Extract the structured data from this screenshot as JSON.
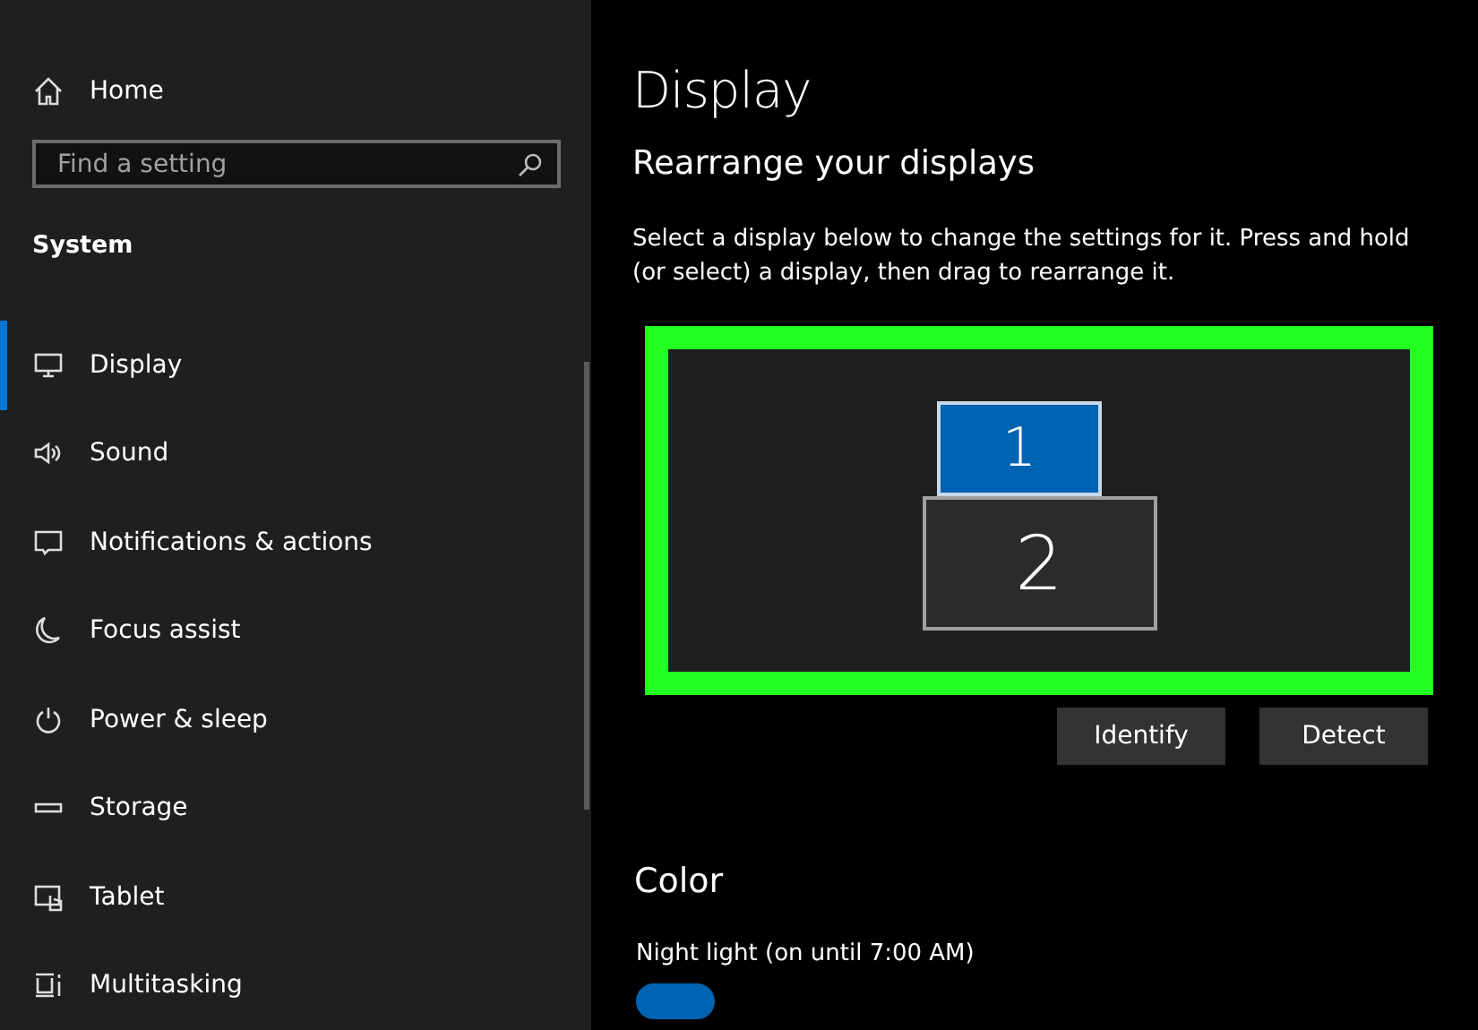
{
  "sidebar": {
    "home": "Home",
    "search": {
      "placeholder": "Find a setting"
    },
    "section": "System",
    "items": [
      {
        "label": "Display",
        "selected": true
      },
      {
        "label": "Sound",
        "selected": false
      },
      {
        "label": "Notifications & actions",
        "selected": false
      },
      {
        "label": "Focus assist",
        "selected": false
      },
      {
        "label": "Power & sleep",
        "selected": false
      },
      {
        "label": "Storage",
        "selected": false
      },
      {
        "label": "Tablet",
        "selected": false
      },
      {
        "label": "Multitasking",
        "selected": false
      }
    ]
  },
  "main": {
    "title": "Display",
    "heading": "Rearrange your displays",
    "description": "Select a display below to change the settings for it. Press and hold (or select) a display, then drag to rearrange it.",
    "displays": [
      {
        "label": "1",
        "selected": true
      },
      {
        "label": "2",
        "selected": false
      }
    ],
    "buttons": [
      "Identify",
      "Detect"
    ],
    "color_heading": "Color",
    "night_light": {
      "label": "Night light (on until 7:00 AM)",
      "on": true
    }
  }
}
